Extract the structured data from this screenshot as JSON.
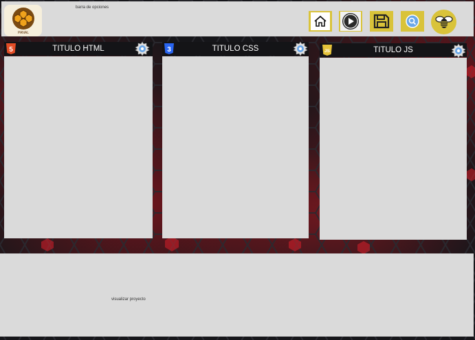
{
  "toolbar": {
    "options_label": "barra de opciones",
    "buttons": [
      {
        "name": "home",
        "icon": "home-icon"
      },
      {
        "name": "run",
        "icon": "play-icon"
      },
      {
        "name": "save",
        "icon": "floppy-disk-icon"
      },
      {
        "name": "search",
        "icon": "search-icon"
      },
      {
        "name": "profile",
        "icon": "bee-icon"
      }
    ]
  },
  "logo": {
    "text": "PANAL"
  },
  "editors": {
    "html": {
      "title": "TITULO HTML",
      "badge": "5",
      "color": "#e44d26"
    },
    "css": {
      "title": "TITULO CSS",
      "badge": "3",
      "color": "#2965f1"
    },
    "js": {
      "title": "TITULO JS",
      "badge": "JS",
      "color": "#e5c33a"
    }
  },
  "preview": {
    "label": "visualizar proyecto"
  },
  "colors": {
    "accent": "#d9c33a",
    "panel": "#dadada",
    "background": "#16161a",
    "glow": "#c8161f"
  }
}
